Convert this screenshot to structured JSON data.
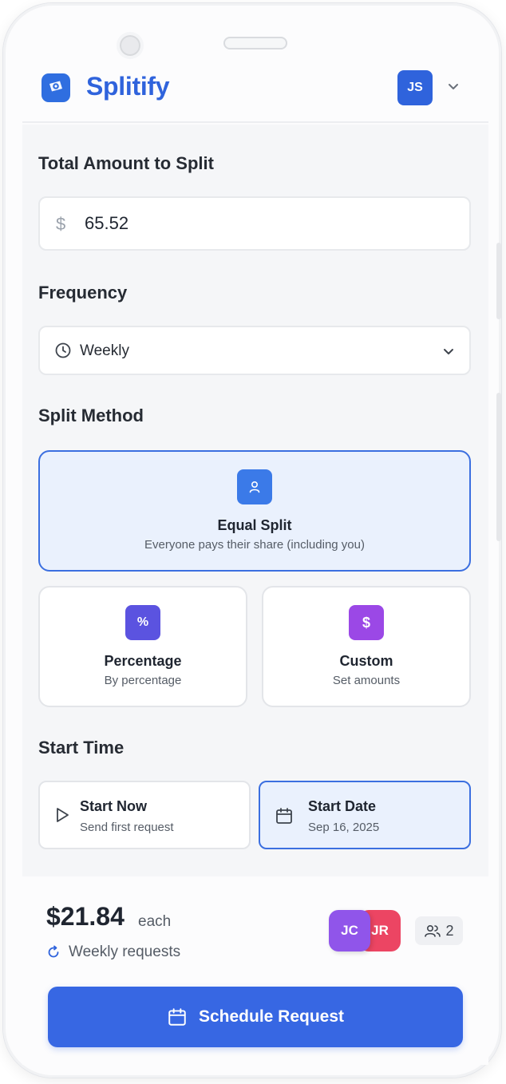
{
  "app": {
    "name": "Splitify",
    "user_initials": "JS"
  },
  "amount": {
    "label": "Total Amount to Split",
    "currency_symbol": "$",
    "value": "65.52"
  },
  "frequency": {
    "label": "Frequency",
    "selected": "Weekly"
  },
  "split_method": {
    "label": "Split Method",
    "options": [
      {
        "id": "equal",
        "title": "Equal Split",
        "description": "Everyone pays their share (including you)",
        "selected": true,
        "color": "#3b7ae8"
      },
      {
        "id": "percentage",
        "title": "Percentage",
        "description": "By percentage",
        "icon_glyph": "%",
        "selected": false,
        "color": "#5b53e0"
      },
      {
        "id": "custom",
        "title": "Custom",
        "description": "Set amounts",
        "icon_glyph": "$",
        "selected": false,
        "color": "#9b48e6"
      }
    ]
  },
  "start_time": {
    "label": "Start Time",
    "options": [
      {
        "id": "now",
        "title": "Start Now",
        "subtitle": "Send first request",
        "selected": false
      },
      {
        "id": "date",
        "title": "Start Date",
        "subtitle": "Sep 16, 2025",
        "selected": true
      }
    ]
  },
  "summary": {
    "amount_each": "$21.84",
    "each_label": "each",
    "frequency_note": "Weekly requests",
    "participants": [
      {
        "initials": "JC",
        "color": "#9055ea"
      },
      {
        "initials": "JR",
        "color": "#ec4563"
      }
    ],
    "participant_count": "2"
  },
  "cta": {
    "label": "Schedule Request"
  },
  "colors": {
    "brand": "#2f63dc",
    "selected_bg": "#eaf1fd",
    "selected_border": "#3b6fe0"
  }
}
